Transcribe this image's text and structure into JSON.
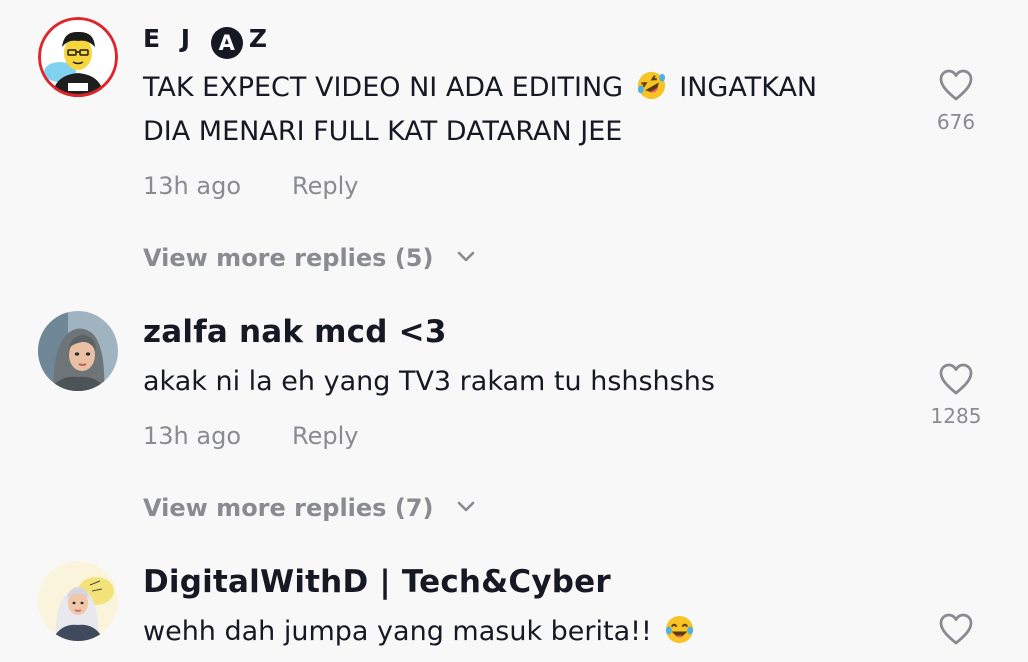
{
  "comments": [
    {
      "username": "E J",
      "username_circle_letter": "A",
      "username_tail": "Z",
      "avatar_icon": "cartoon-boy-avatar",
      "text_line1_before": "TAK EXPECT VIDEO NI ADA EDITING",
      "text_line1_emoji": "rofl-emoji",
      "text_line1_after": "INGATKAN",
      "text_line2": "DIA MENARI FULL KAT DATARAN JEE",
      "time": "13h ago",
      "reply_label": "Reply",
      "likes": "676",
      "view_more": "View more replies (5)"
    },
    {
      "username": "zalfa nak mcd <3",
      "avatar_icon": "hijab-girl-avatar",
      "text": "akak ni la eh yang TV3 rakam tu hshshshs",
      "time": "13h ago",
      "reply_label": "Reply",
      "likes": "1285",
      "view_more": "View more replies (7)"
    },
    {
      "username": "DigitalWithD | Tech&Cyber",
      "avatar_icon": "illustrated-woman-avatar",
      "text": "wehh dah jumpa yang masuk berita!!",
      "text_emoji": "joy-emoji"
    }
  ],
  "colors": {
    "background": "#f8f8f8",
    "primary_text": "#161823",
    "secondary_text": "#8a8b91",
    "icon_gray": "#8a8b91"
  }
}
